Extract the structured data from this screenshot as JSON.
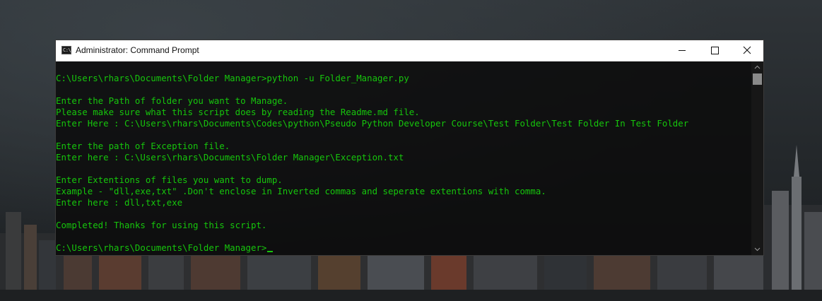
{
  "window": {
    "title": "Administrator: Command Prompt",
    "icon_text": "C:\\",
    "icon": "console-icon",
    "controls": {
      "minimize": "minimize-icon",
      "maximize": "maximize-icon",
      "close": "close-icon"
    }
  },
  "console": {
    "text_color": "#16c60c",
    "lines": [
      "C:\\Users\\rhars\\Documents\\Folder Manager>python -u Folder_Manager.py",
      "",
      "Enter the Path of folder you want to Manage.",
      "Please make sure what this script does by reading the Readme.md file.",
      "Enter Here : C:\\Users\\rhars\\Documents\\Codes\\python\\Pseudo Python Developer Course\\Test Folder\\Test Folder In Test Folder",
      "",
      "Enter the path of Exception file.",
      "Enter here : C:\\Users\\rhars\\Documents\\Folder Manager\\Exception.txt",
      "",
      "Enter Extentions of files you want to dump.",
      "Example - \"dll,exe,txt\" .Don't enclose in Inverted commas and seperate extentions with comma.",
      "Enter here : dll,txt,exe",
      "",
      "Completed! Thanks for using this script.",
      "",
      "C:\\Users\\rhars\\Documents\\Folder Manager>"
    ]
  }
}
